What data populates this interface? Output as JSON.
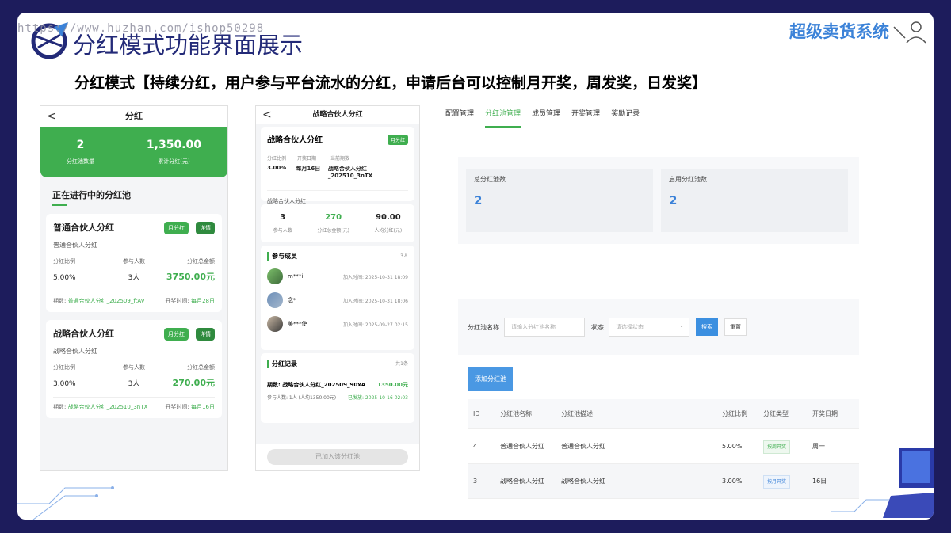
{
  "header": {
    "watermark": "https://www.huzhan.com/ishop50298",
    "title": "分红模式功能界面展示",
    "brand": "超级卖货系统",
    "subtitle": "分红模式【持续分红，用户参与平台流水的分红，申请后台可以控制月开奖，周发奖，日发奖】"
  },
  "phone1": {
    "back": "<",
    "title": "分红",
    "stats": [
      {
        "value": "2",
        "label": "分红池数量"
      },
      {
        "value": "1,350.00",
        "label": "累计分红(元)"
      }
    ],
    "section_title": "正在进行中的分红池",
    "cards": [
      {
        "title": "普通合伙人分红",
        "tag": "月分红",
        "detail": "详情",
        "sub": "普通合伙人分红",
        "col_ratio": "分红比例",
        "col_people": "参与人数",
        "col_total": "分红总金额",
        "ratio": "5.00%",
        "people": "3人",
        "total": "3750.00元",
        "period_label": "期数:",
        "period": "普通合伙人分红_202509_ftAV",
        "draw_label": "开奖时间:",
        "draw": "每月28日"
      },
      {
        "title": "战略合伙人分红",
        "tag": "月分红",
        "detail": "详情",
        "sub": "战略合伙人分红",
        "col_ratio": "分红比例",
        "col_people": "参与人数",
        "col_total": "分红总金额",
        "ratio": "3.00%",
        "people": "3人",
        "total": "270.00元",
        "period_label": "期数:",
        "period": "战略合伙人分红_202510_3nTX",
        "draw_label": "开奖时间:",
        "draw": "每月16日"
      }
    ]
  },
  "phone2": {
    "back": "<",
    "title": "战略合伙人分红",
    "card_title": "战略合伙人分红",
    "tag": "月分红",
    "h_ratio": "分红比例",
    "h_draw": "开奖日期",
    "h_period": "当前期数",
    "ratio": "3.00%",
    "draw": "每月16日",
    "period": "战略合伙人分红_202510_3nTX",
    "desc": "战略合伙人分红",
    "stats": [
      {
        "value": "3",
        "label": "参与人数"
      },
      {
        "value": "270",
        "label": "分红总金额(元)"
      },
      {
        "value": "90.00",
        "label": "人均分红(元)"
      }
    ],
    "members_title": "参与成员",
    "members_count": "3人",
    "members": [
      {
        "name": "m***i",
        "time": "加入时间: 2025-10-31 18:09"
      },
      {
        "name": "念*",
        "time": "加入时间: 2025-10-31 18:06"
      },
      {
        "name": "美***使",
        "time": "加入时间: 2025-09-27 02:15"
      }
    ],
    "records_title": "分红记录",
    "records_count": "共1条",
    "record_period": "期数: 战略合伙人分红_202509_90xA",
    "record_amount": "1350.00元",
    "record_people": "参与人数: 1人 (人均1350.00元)",
    "record_status": "已发放: 2025-10-16 02:03",
    "joined_button": "已加入该分红池"
  },
  "admin": {
    "tabs": [
      "配置管理",
      "分红池管理",
      "成员管理",
      "开奖管理",
      "奖励记录"
    ],
    "active_tab": 1,
    "stat_total_label": "总分红池数",
    "stat_total_value": "2",
    "stat_enabled_label": "启用分红池数",
    "stat_enabled_value": "2",
    "filter_name_label": "分红池名称",
    "filter_name_placeholder": "请输入分红池名称",
    "filter_status_label": "状态",
    "filter_status_placeholder": "请选择状态",
    "search_button": "搜索",
    "reset_button": "重置",
    "add_button": "添加分红池",
    "columns": [
      "ID",
      "分红池名称",
      "分红池描述",
      "分红比例",
      "分红类型",
      "开奖日期"
    ],
    "rows": [
      {
        "id": "4",
        "name": "普通合伙人分红",
        "desc": "普通合伙人分红",
        "ratio": "5.00%",
        "type": "按周开奖",
        "day": "周一"
      },
      {
        "id": "3",
        "name": "战略合伙人分红",
        "desc": "战略合伙人分红",
        "ratio": "3.00%",
        "type": "按月开奖",
        "day": "16日"
      }
    ]
  },
  "colors": {
    "background": "#1d1c5c",
    "accent_green": "#3fae4f",
    "accent_blue": "#3b82d8",
    "title_navy": "#232a78"
  }
}
